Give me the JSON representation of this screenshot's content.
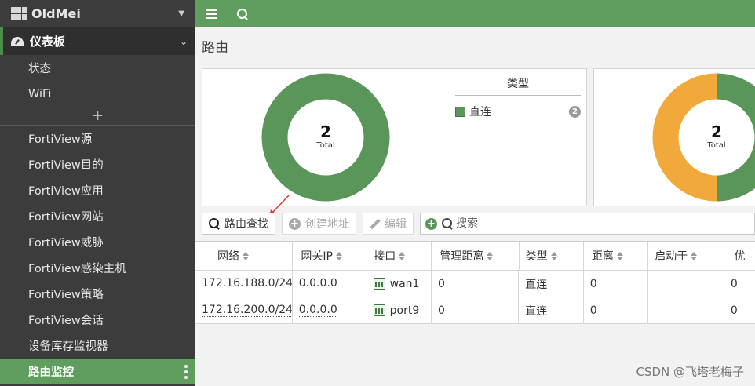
{
  "sidebar": {
    "brand": "OldMei",
    "section_label": "仪表板",
    "items": [
      {
        "label": "状态"
      },
      {
        "label": "WiFi"
      },
      {
        "label": "FortiView源"
      },
      {
        "label": "FortiView目的"
      },
      {
        "label": "FortiView应用"
      },
      {
        "label": "FortiView网站"
      },
      {
        "label": "FortiView威胁"
      },
      {
        "label": "FortiView感染主机"
      },
      {
        "label": "FortiView策略"
      },
      {
        "label": "FortiView会话"
      },
      {
        "label": "设备库存监视器"
      }
    ],
    "add_symbol": "+",
    "active_item": "路由监控"
  },
  "topbar": {
    "icons": [
      "menu-icon",
      "search-icon"
    ]
  },
  "main": {
    "page_title": "路由"
  },
  "widgets": [
    {
      "total": "2",
      "total_label": "Total",
      "legend_title": "类型",
      "legend": [
        {
          "label": "直连",
          "count": "2",
          "color": "#5a965a"
        }
      ]
    },
    {
      "total": "2",
      "total_label": "Total",
      "segments": [
        {
          "color": "#5a965a",
          "fraction": 0.5
        },
        {
          "color": "#f0a93a",
          "fraction": 0.5
        }
      ]
    }
  ],
  "toolbar": {
    "lookup_label": "路由查找",
    "create_label": "创建地址",
    "edit_label": "编辑",
    "search_placeholder": "搜索"
  },
  "table": {
    "columns": [
      "网络",
      "网关IP",
      "接口",
      "管理距离",
      "类型",
      "距离",
      "启动于",
      "优"
    ],
    "rows": [
      {
        "network": "172.16.188.0/24",
        "gateway": "0.0.0.0",
        "interface": "wan1",
        "admin_distance": "0",
        "type": "直连",
        "distance": "0",
        "up_since": "",
        "priority": "0"
      },
      {
        "network": "172.16.200.0/24",
        "gateway": "0.0.0.0",
        "interface": "port9",
        "admin_distance": "0",
        "type": "直连",
        "distance": "0",
        "up_since": "",
        "priority": "0"
      }
    ]
  },
  "colors": {
    "accent": "#5f9e5f",
    "sidebar_bg": "#3c3c3c",
    "donut_green": "#5a965a",
    "donut_orange": "#f0a93a",
    "annotation_red": "#e03c31"
  },
  "watermark": "CSDN @飞塔老梅子"
}
